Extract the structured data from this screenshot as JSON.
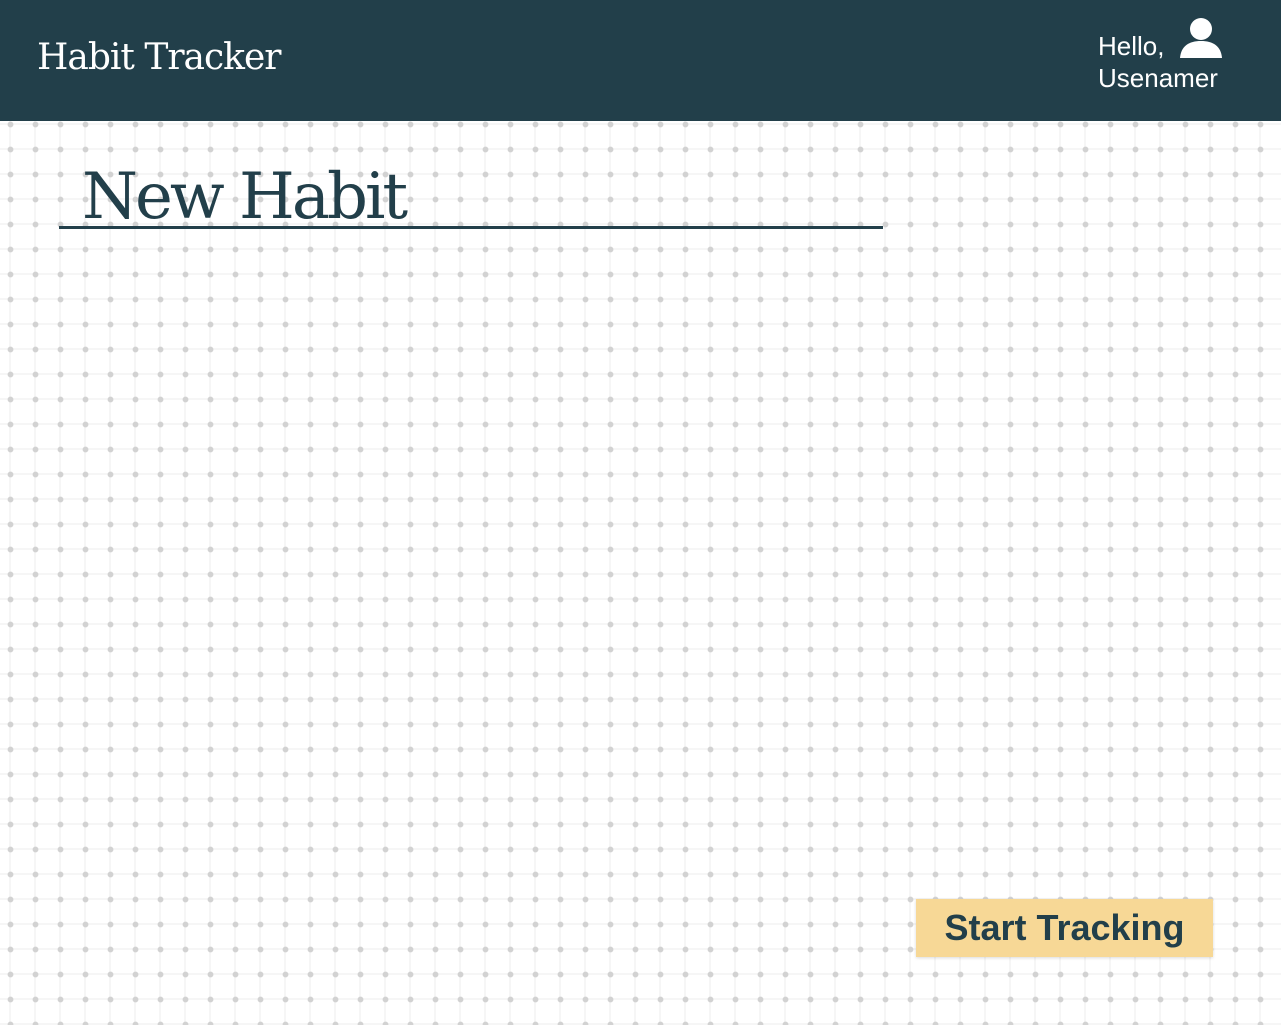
{
  "header": {
    "app_title": "Habit Tracker",
    "greeting": "Hello,",
    "username": "Usenamer",
    "user_icon": "user-icon",
    "background_color": "#223f4a"
  },
  "main": {
    "page_title": "New Habit",
    "start_button_label": "Start Tracking",
    "button_color": "#f7d896",
    "text_color": "#223f4a"
  }
}
